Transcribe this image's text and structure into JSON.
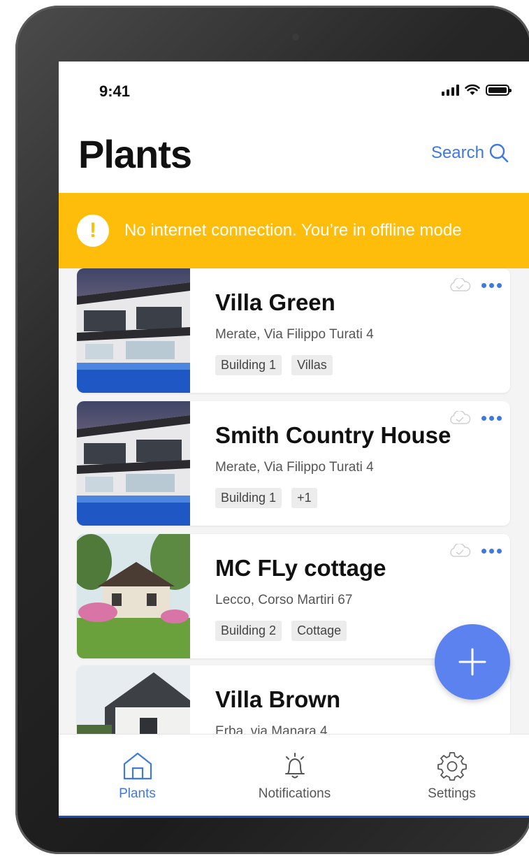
{
  "status_bar": {
    "time": "9:41"
  },
  "header": {
    "title": "Plants",
    "search_label": "Search"
  },
  "banner": {
    "icon_text": "!",
    "message": "No internet connection. You’re in offline mode"
  },
  "plants": [
    {
      "name": "Villa Green",
      "address": "Merate, Via Filippo Turati 4",
      "tags": [
        "Building 1",
        "Villas"
      ],
      "thumb": "pool-villa"
    },
    {
      "name": "Smith Country House",
      "address": "Merate, Via Filippo Turati 4",
      "tags": [
        "Building 1",
        "+1"
      ],
      "thumb": "pool-villa"
    },
    {
      "name": "MC FLy cottage",
      "address": "Lecco, Corso Martiri 67",
      "tags": [
        "Building 2",
        "Cottage"
      ],
      "thumb": "cottage"
    },
    {
      "name": "Villa Brown",
      "address": "Erba, via Manara 4",
      "tags": [],
      "thumb": "modern-house"
    }
  ],
  "nav": [
    {
      "label": "Plants",
      "icon": "home-icon",
      "active": true
    },
    {
      "label": "Notifications",
      "icon": "bell-icon",
      "active": false
    },
    {
      "label": "Settings",
      "icon": "gear-icon",
      "active": false
    }
  ],
  "colors": {
    "accent": "#3f78e0",
    "banner": "#fdbd0a",
    "fab": "#5b82ef"
  }
}
